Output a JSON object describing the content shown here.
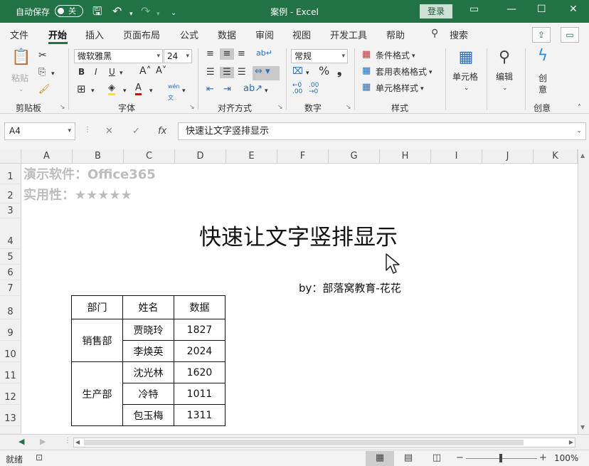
{
  "titlebar": {
    "autosave_label": "自动保存",
    "autosave_state": "关",
    "title": "案例  -  Excel",
    "login": "登录"
  },
  "menu": {
    "tabs": [
      "文件",
      "开始",
      "插入",
      "页面布局",
      "公式",
      "数据",
      "审阅",
      "视图",
      "开发工具",
      "帮助"
    ],
    "active": "开始",
    "search": "搜索"
  },
  "ribbon": {
    "clipboard": {
      "paste": "粘贴",
      "label": "剪贴板"
    },
    "font": {
      "name": "微软雅黑",
      "size": "24",
      "label": "字体"
    },
    "alignment": {
      "label": "对齐方式"
    },
    "number": {
      "format": "常规",
      "label": "数字"
    },
    "styles": {
      "conditional": "条件格式",
      "table": "套用表格格式",
      "cell": "单元格样式",
      "label": "样式"
    },
    "cells": {
      "label": "单元格"
    },
    "editing": {
      "label": "编辑"
    },
    "create": {
      "btn_line1": "创",
      "btn_line2": "意",
      "label": "创意"
    }
  },
  "formula_bar": {
    "name_box": "A4",
    "fx": "fx",
    "content": "快速让文字竖排显示"
  },
  "grid": {
    "columns": [
      "A",
      "B",
      "C",
      "D",
      "E",
      "F",
      "G",
      "H",
      "I",
      "J",
      "K"
    ],
    "rows": [
      "1",
      "2",
      "3",
      "4",
      "5",
      "6",
      "7",
      "8",
      "9",
      "10",
      "11",
      "12",
      "13"
    ],
    "demo_software": "演示软件：Office365",
    "usability": "实用性：★★★★★",
    "title": "快速让文字竖排显示",
    "byline": "by：部落窝教育-花花"
  },
  "table": {
    "headers": [
      "部门",
      "姓名",
      "数据"
    ],
    "groups": [
      {
        "dept": "销售部",
        "rows": [
          {
            "name": "贾晓玲",
            "value": "1827"
          },
          {
            "name": "李焕英",
            "value": "2024"
          }
        ]
      },
      {
        "dept": "生产部",
        "rows": [
          {
            "name": "沈光林",
            "value": "1620"
          },
          {
            "name": "冷特",
            "value": "1011"
          },
          {
            "name": "包玉梅",
            "value": "1311"
          }
        ]
      }
    ]
  },
  "statusbar": {
    "ready": "就绪",
    "zoom": "100%"
  }
}
